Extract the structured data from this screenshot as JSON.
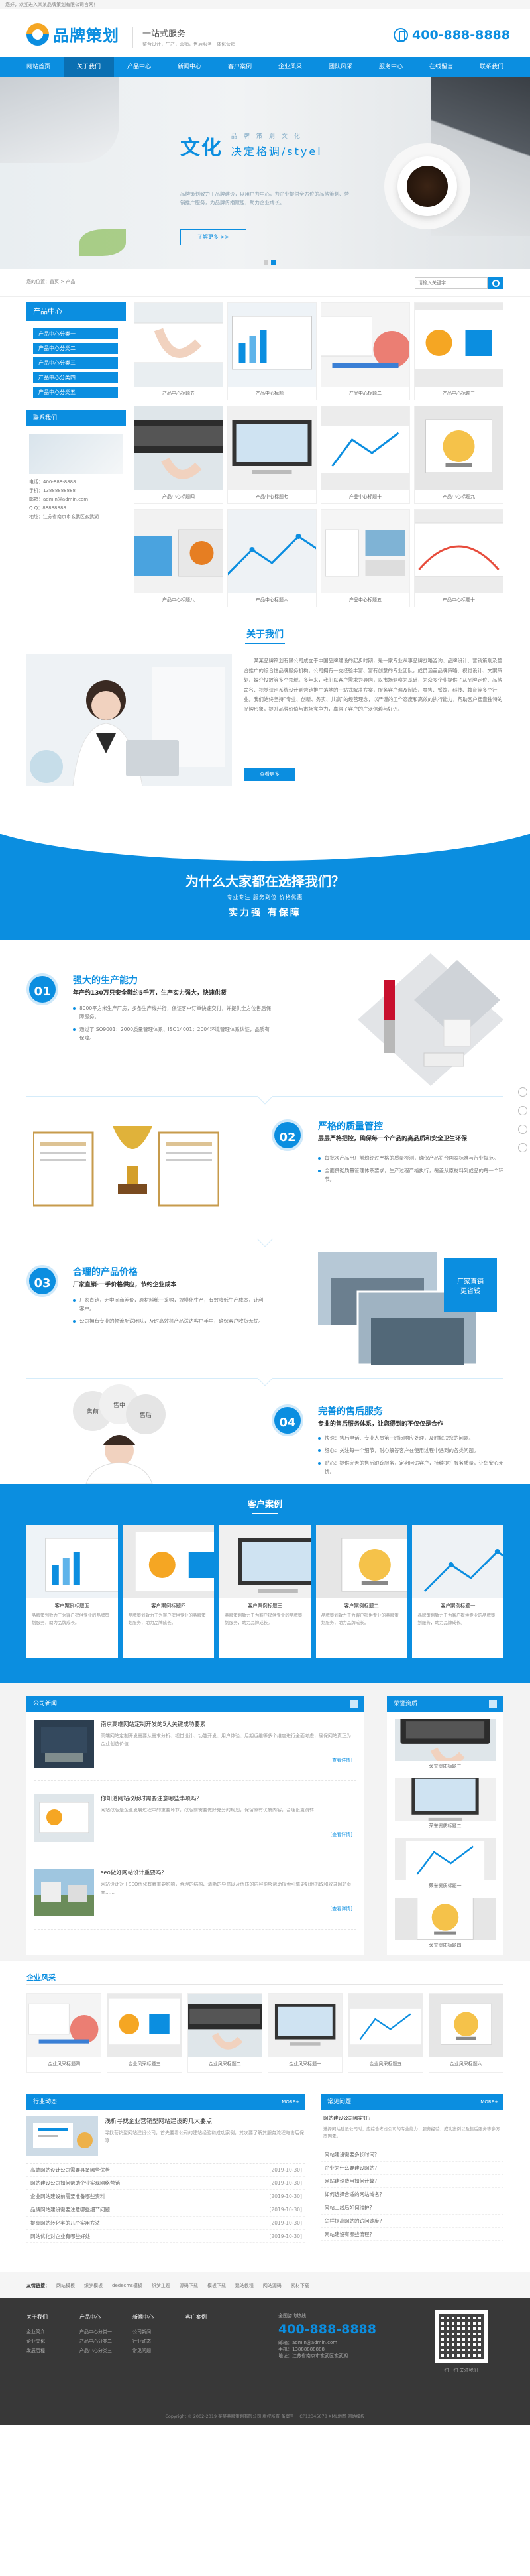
{
  "topbar": {
    "text": "您好，欢迎进入某某品牌策划有限公司官网！"
  },
  "header": {
    "logo_text": "品牌策划",
    "slogan_title": "一站式服务",
    "slogan_sub": "整合设计，生产，营销，售后服务一体化营销",
    "hotline": "400-888-8888"
  },
  "nav": [
    "网站首页",
    "关于我们",
    "产品中心",
    "新闻中心",
    "客户案例",
    "企业风采",
    "团队风采",
    "服务中心",
    "在线留言",
    "联系我们"
  ],
  "banner": {
    "big": "文化",
    "spaced": "品牌策划文化",
    "title": "决定格调/styel",
    "desc": "品牌策划致力于品牌建设，以用户为中心，为企业提供全方位的品牌策划、营销推广服务，为品牌传播赋能，助力企业成长。",
    "button": "了解更多 >>"
  },
  "crumb": "您的位置：首页 > 产品",
  "search": {
    "placeholder": "请输入关键字"
  },
  "side": {
    "title": "产品中心",
    "items": [
      "产品中心分类一",
      "产品中心分类二",
      "产品中心分类三",
      "产品中心分类四",
      "产品中心分类五"
    ],
    "contact_title": "联系我们",
    "contact_lines": [
      "电话：400-888-8888",
      "手机：13888888888",
      "邮箱：admin@admin.com",
      "Q Q：88888888",
      "地址：江苏省南京市玄武区玄武湖"
    ]
  },
  "products": [
    "产品中心标题五",
    "产品中心标题一",
    "产品中心标题二",
    "产品中心标题三",
    "产品中心标题四",
    "产品中心标题七",
    "产品中心标题十",
    "产品中心标题九",
    "产品中心标题八",
    "产品中心标题六",
    "产品中心标题五",
    "产品中心标题十"
  ],
  "about": {
    "title": "关于我们",
    "text": "某某品牌策划有限公司成立于中国品牌建设的起步时期，是一家专业从事品牌战略咨询、品牌设计、营销策划及整合推广的综合性品牌服务机构。公司拥有一支经验丰富、富有创意的专业团队，成员涵盖品牌策略、视觉设计、文案策划、媒介投放等多个领域。多年来，我们以客户需求为导向，以市场洞察为基础，为众多企业提供了从品牌定位、品牌命名、视觉识别系统设计到营销推广落地的一站式解决方案，服务客户遍及制造、零售、餐饮、科技、教育等多个行业。我们始终坚持“专业、创新、务实、共赢”的经营理念，以严谨的工作态度和高效的执行能力，帮助客户塑造独特的品牌形象，提升品牌价值与市场竞争力，赢得了客户的广泛信赖与好评。",
    "button": "查看更多"
  },
  "why": {
    "title": "为什么大家都在选择我们？",
    "sub": "专业专注  服务到位  价格优惠",
    "sub2": "实力强 有保障"
  },
  "adv": [
    {
      "num": "01",
      "title": "强大的生产能力",
      "sub": "年产约130万只安全鞋约5千万，生产实力强大，快速供货",
      "items": [
        "8000平方米生产厂房，多条生产线并行，保证客户订单快速交付，并提供全方位售后保障服务。",
        "通过了ISO9001：2000质量管理体系、ISO14001：2004环境管理体系认证，品质有保障。"
      ]
    },
    {
      "num": "02",
      "title": "严格的质量管控",
      "sub": "层层严格把控，确保每一个产品的高品质和安全卫生环保",
      "items": [
        "每批次产品出厂前均经过严格的质量检测，确保产品符合国家标准与行业规范。",
        "全面贯彻质量管理体系要求，生产过程严格执行，覆盖从原材料到成品的每一个环节。"
      ]
    },
    {
      "num": "03",
      "title": "合理的产品价格",
      "sub": "厂家直销·一手价格供应，节约企业成本",
      "items": [
        "厂家直销，无中间商差价，原材料统一采购，规模化生产，有效降低生产成本，让利于客户。",
        "公司拥有专业的物流配送团队，及时高效将产品送达客户手中，确保客户收货无忧。"
      ]
    },
    {
      "num": "04",
      "title": "完善的售后服务",
      "sub": "专业的售后服务体系，让您得到的不仅仅是合作",
      "items": [
        "快速：售后电话、专业人员第一时间响应处理，及时解决您的问题。",
        "细心：关注每一个细节，耐心解答客户在使用过程中遇到的各类问题。",
        "贴心：提供完善的售后跟踪服务，定期回访客户，持续提升服务质量，让您安心无忧。"
      ]
    }
  ],
  "adv2_captions": [
    "厂家直销",
    "更省钱"
  ],
  "adv4_labels": [
    "售前",
    "售中",
    "售后"
  ],
  "cases": {
    "title": "客户案例",
    "items": [
      {
        "title": "客户案例标题五",
        "desc": "品牌策划致力于为客户提供专业的品牌策划服务，助力品牌成长。"
      },
      {
        "title": "客户案例标题四",
        "desc": "品牌策划致力于为客户提供专业的品牌策划服务，助力品牌成长。"
      },
      {
        "title": "客户案例标题三",
        "desc": "品牌策划致力于为客户提供专业的品牌策划服务，助力品牌成长。"
      },
      {
        "title": "客户案例标题二",
        "desc": "品牌策划致力于为客户提供专业的品牌策划服务，助力品牌成长。"
      },
      {
        "title": "客户案例标题一",
        "desc": "品牌策划致力于为客户提供专业的品牌策划服务，助力品牌成长。"
      }
    ]
  },
  "news": {
    "title": "公司新闻",
    "items": [
      {
        "title": "南京高端网站定制开发的5大关键成功要素",
        "desc": "高端网站定制开发需要从需求分析、视觉设计、功能开发、用户体验、后期运维等多个维度进行全面考虑，确保网站真正为企业创造价值……",
        "more": "[查看详情]"
      },
      {
        "title": "你知道网站改版时需要注意哪些事项吗？",
        "desc": "网站改版是企业发展过程中的重要环节，改版前需要做好充分的规划，保留原有优质内容，合理设置跳转……",
        "more": "[查看详情]"
      },
      {
        "title": "seo做好网站设计重要吗？",
        "desc": "网站设计对于SEO优化有着重要影响，合理的结构、清晰的导航以及优质的内容能够帮助搜索引擎更好地抓取和收录网站页面……",
        "more": "[查看详情]"
      }
    ],
    "honor_title": "荣誉资质",
    "honors": [
      "荣誉资质标题三",
      "荣誉资质标题二",
      "荣誉资质标题一",
      "荣誉资质标题四"
    ]
  },
  "style": {
    "title": "企业风采",
    "items": [
      "企业风采标题四",
      "企业风采标题三",
      "企业风采标题二",
      "企业风采标题一",
      "企业风采标题五",
      "企业风采标题六"
    ]
  },
  "industry": {
    "title": "行业动态",
    "more": "MORE+",
    "feature": {
      "title": "浅析寻找企业营销型网站建设的几大要点",
      "desc": "寻找营销型网站建设公司，首先要看公司的建站经验和成功案例，其次要了解其服务流程与售后保障……"
    },
    "list": [
      {
        "t": "高端网站设计公司需要具备哪些优势",
        "d": "[2019-10-30]"
      },
      {
        "t": "网站建设公司如何帮助企业实现网络营销",
        "d": "[2019-10-30]"
      },
      {
        "t": "企业网站建设前需要准备哪些资料",
        "d": "[2019-10-30]"
      },
      {
        "t": "品牌网站建设需要注意哪些细节问题",
        "d": "[2019-10-30]"
      },
      {
        "t": "提高网站转化率的几个实用方法",
        "d": "[2019-10-30]"
      },
      {
        "t": "网站优化对企业有哪些好处",
        "d": "[2019-10-30]"
      }
    ]
  },
  "faq": {
    "title": "常见问题",
    "more": "MORE+",
    "feature": {
      "q": "网站建设公司哪家好？",
      "a": "选择网站建设公司时，应综合考虑公司的专业能力、服务经验、成功案例以及售后服务等多方面因素。"
    },
    "list": [
      "网站建设需要多长时间？",
      "企业为什么要建设网站？",
      "网站建设费用如何计算？",
      "如何选择合适的网站域名？",
      "网站上线后如何维护？",
      "怎样提高网站的访问速度？",
      "网站建设有哪些流程？"
    ]
  },
  "links": {
    "label": "友情链接：",
    "items": [
      "网站模板",
      "织梦模板",
      "dedecms模板",
      "织梦主题",
      "源码下载",
      "模板下载",
      "建站教程",
      "网站源码",
      "素材下载"
    ]
  },
  "footer": {
    "cols": [
      {
        "title": "关于我们",
        "items": [
          "企业简介",
          "企业文化",
          "发展历程"
        ]
      },
      {
        "title": "产品中心",
        "items": [
          "产品中心分类一",
          "产品中心分类二",
          "产品中心分类三"
        ]
      },
      {
        "title": "新闻中心",
        "items": [
          "公司新闻",
          "行业动态",
          "常见问题"
        ]
      },
      {
        "title": "客户案例",
        "items": []
      }
    ],
    "contact_label": "全国咨询热线",
    "tel": "400-888-8888",
    "mail": "邮箱：admin@admin.com",
    "phone": "手机：13888888888",
    "addr": "地址：江苏省南京市玄武区玄武湖",
    "qr_caption": "扫一扫 关注我们",
    "copyright": "Copyright © 2002-2019 某某品牌策划有限公司 版权所有  备案号：ICP12345678  XML地图  网站模板"
  }
}
